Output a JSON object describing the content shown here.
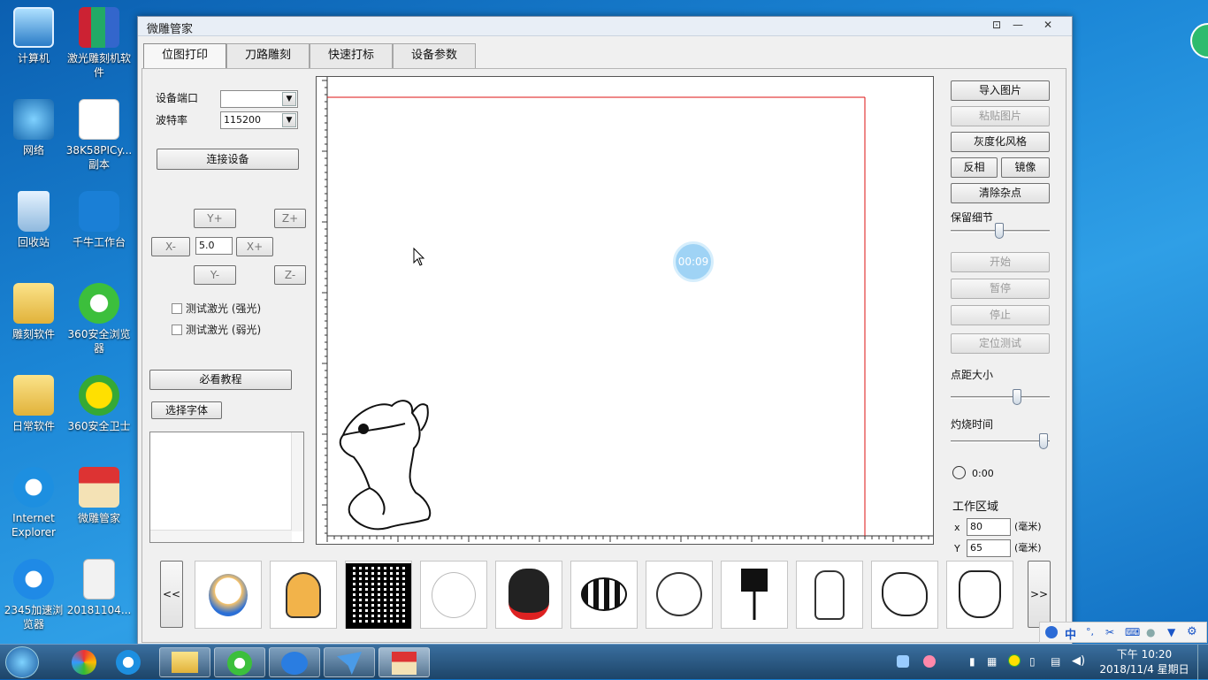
{
  "desktop": {
    "icons": [
      "计算机",
      "激光雕刻机软件",
      "网络",
      "38K58PICy... 副本",
      "回收站",
      "千牛工作台",
      "雕刻软件",
      "360安全浏览器",
      "日常软件",
      "360安全卫士",
      "Internet Explorer",
      "微雕管家",
      "2345加速浏览器",
      "20181104..."
    ]
  },
  "window": {
    "title": "微雕管家",
    "tabs": [
      "位图打印",
      "刀路雕刻",
      "快速打标",
      "设备参数"
    ]
  },
  "left": {
    "port_label": "设备端口",
    "port_value": "",
    "baud_label": "波特率",
    "baud_value": "115200",
    "connect": "连接设备",
    "y_plus": "Y+",
    "z_plus": "Z+",
    "x_minus": "X-",
    "step": "5.0",
    "x_plus": "X+",
    "y_minus": "Y-",
    "z_minus": "Z-",
    "laser_strong": "测试激光 (强光)",
    "laser_weak": "测试激光 (弱光)",
    "tutorial": "必看教程",
    "choose_font": "选择字体"
  },
  "canvas": {
    "timer": "00:09"
  },
  "right": {
    "import": "导入图片",
    "paste": "粘贴图片",
    "gray": "灰度化风格",
    "invert": "反相",
    "mirror": "镜像",
    "denoise": "清除杂点",
    "detail_label": "保留细节",
    "detail": 0.5,
    "start": "开始",
    "pause": "暂停",
    "stop": "停止",
    "locate": "定位测试",
    "dot_label": "点距大小",
    "dot": 0.7,
    "burn_label": "灼烧时间",
    "burn": 1.0,
    "time": "0:00",
    "work_area": "工作区域",
    "x_label": "x",
    "x_value": "80",
    "y_label": "Y",
    "y_value": "65",
    "unit": "(毫米)"
  },
  "gallery": {
    "prev": "<<",
    "next": ">>"
  },
  "tray": {
    "time": "下午 10:20",
    "date": "2018/11/4 星期日",
    "ime": "中"
  },
  "colors": {
    "laser_line": "#d11",
    "timer": "#9fd3f5"
  }
}
